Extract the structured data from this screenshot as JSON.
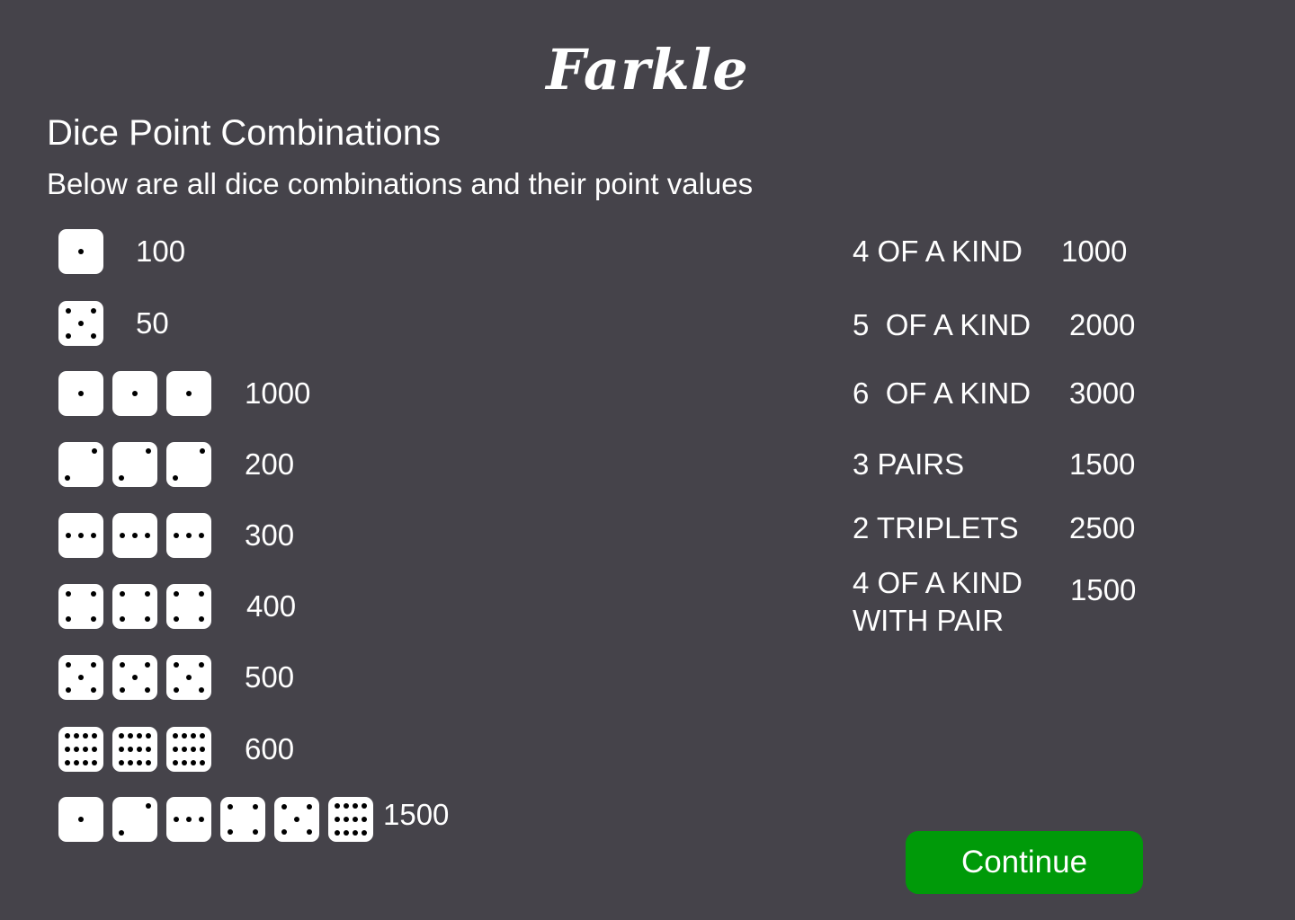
{
  "title": "Farkle",
  "heading": "Dice Point Combinations",
  "subheading": "Below are all dice combinations and their point values",
  "dice_rows": [
    {
      "dice": [
        1
      ],
      "points": "100"
    },
    {
      "dice": [
        5
      ],
      "points": "50"
    },
    {
      "dice": [
        1,
        1,
        1
      ],
      "points": "1000"
    },
    {
      "dice": [
        2,
        2,
        2
      ],
      "points": "200"
    },
    {
      "dice": [
        3,
        3,
        3
      ],
      "points": "300"
    },
    {
      "dice": [
        4,
        4,
        4
      ],
      "points": "400"
    },
    {
      "dice": [
        5,
        5,
        5
      ],
      "points": "500"
    },
    {
      "dice": [
        6,
        6,
        6
      ],
      "points": "600"
    },
    {
      "dice": [
        1,
        2,
        3,
        4,
        5,
        6
      ],
      "points": "1500"
    }
  ],
  "combos": [
    {
      "label": "4 OF A KIND",
      "points": "1000"
    },
    {
      "label": "5  OF A KIND",
      "points": "2000"
    },
    {
      "label": "6  OF A KIND",
      "points": "3000"
    },
    {
      "label": "3 PAIRS",
      "points": "1500"
    },
    {
      "label": "2 TRIPLETS",
      "points": "2500"
    },
    {
      "label": "4 OF A KIND WITH PAIR",
      "points": "1500"
    }
  ],
  "continue_label": "Continue",
  "colors": {
    "background": "#45434a",
    "button": "#009a09",
    "die_face": "#ffffff",
    "pip": "#000000"
  }
}
